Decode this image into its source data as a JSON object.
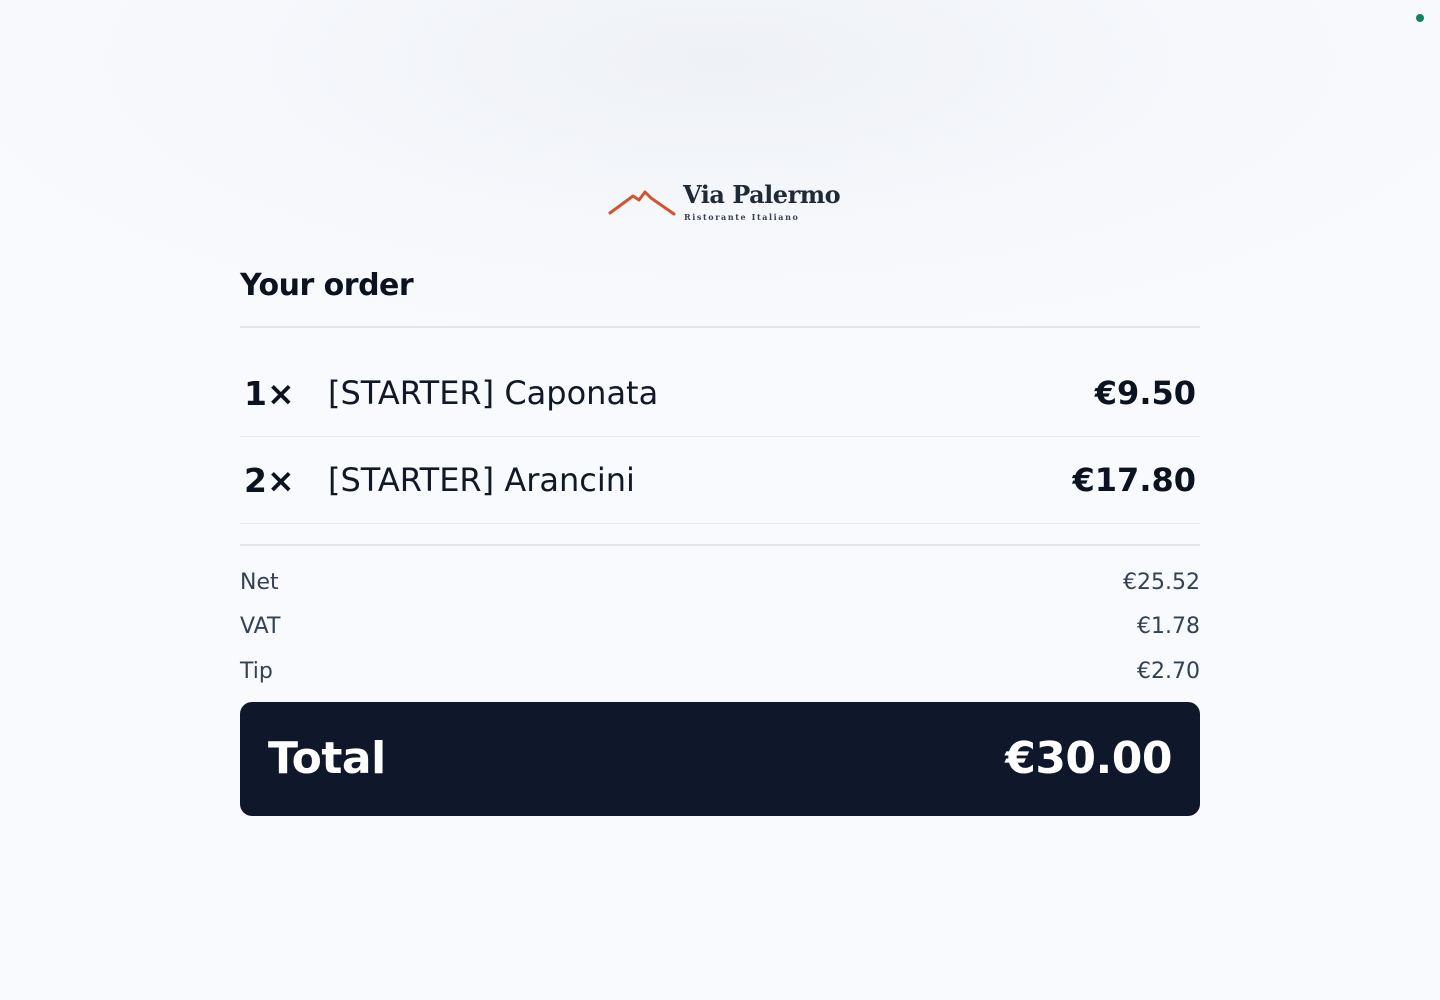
{
  "brand": {
    "name": "Via Palermo",
    "tagline": "Ristorante Italiano",
    "logo_icon": "mountain-icon",
    "accent_color": "#d2542e"
  },
  "status_dot_color": "#10865c",
  "order": {
    "title": "Your order",
    "items": [
      {
        "qty": "1×",
        "name": "[STARTER] Caponata",
        "price": "€9.50"
      },
      {
        "qty": "2×",
        "name": "[STARTER] Arancini",
        "price": "€17.80"
      }
    ]
  },
  "summary": {
    "net_label": "Net",
    "net_value": "€25.52",
    "vat_label": "VAT",
    "vat_value": "€1.78",
    "tip_label": "Tip",
    "tip_value": "€2.70"
  },
  "total": {
    "label": "Total",
    "value": "€30.00",
    "background_color": "#0f172a"
  }
}
